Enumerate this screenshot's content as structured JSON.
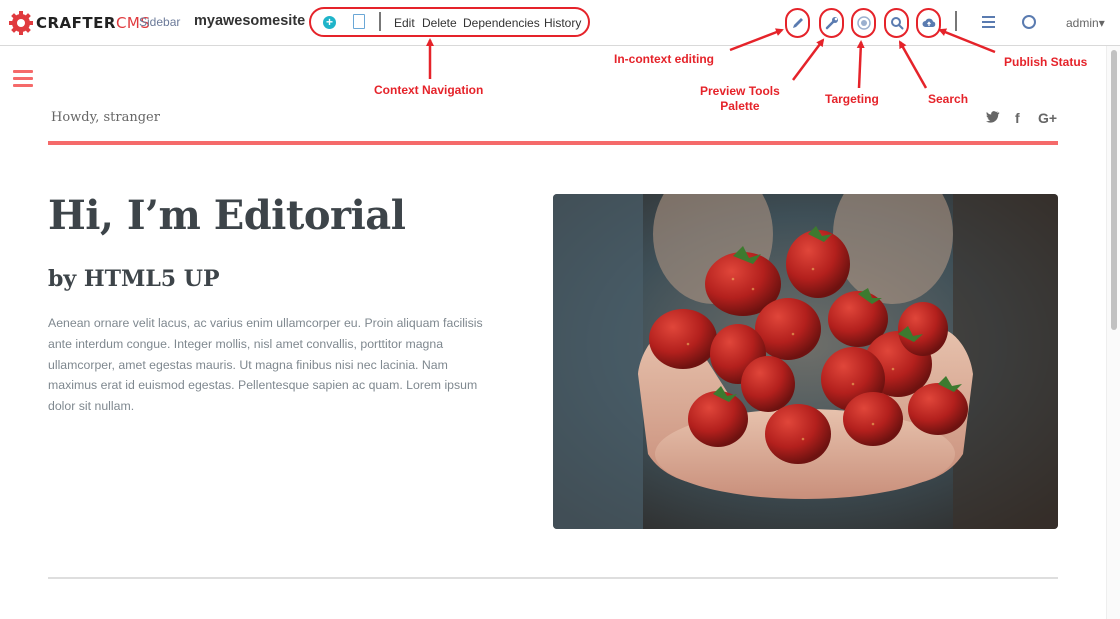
{
  "toolbar": {
    "logo_text_a": "CRAFTER",
    "logo_text_b": "CMS",
    "sidebar_label": "Sidebar",
    "site_name": "myawesomesite",
    "context_nav": {
      "add_icon_glyph": "+",
      "items": [
        "Edit",
        "Delete",
        "Dependencies",
        "History"
      ]
    },
    "user": "admin",
    "user_caret": "▾",
    "icons": [
      "pencil-icon",
      "wrench-icon",
      "target-icon",
      "search-icon",
      "cloud-upload-icon",
      "menu-icon",
      "globe-icon"
    ]
  },
  "annotations": {
    "context_navigation": "Context Navigation",
    "in_context_editing": "In-context editing",
    "preview_tools_palette_line1": "Preview Tools",
    "preview_tools_palette_line2": "Palette",
    "targeting": "Targeting",
    "search": "Search",
    "publish_status": "Publish Status"
  },
  "site": {
    "greeting": "Howdy, stranger",
    "social": [
      "twitter-icon",
      "facebook-icon",
      "google-plus-icon"
    ],
    "social_glyphs": {
      "twitter": "🐦",
      "facebook": "f",
      "gplus": "G+"
    },
    "hero_title": "Hi, I’m Editorial",
    "hero_subtitle": "by HTML5 UP",
    "hero_body": "Aenean ornare velit lacus, ac varius enim ullamcorper eu. Proin aliquam facilisis ante interdum congue. Integer mollis, nisl amet convallis, porttitor magna ullamcorper, amet egestas mauris. Ut magna finibus nisi nec lacinia. Nam maximus erat id euismod egestas. Pellentesque sapien ac quam. Lorem ipsum dolor sit nullam.",
    "hero_image": "strawberries-in-hands-image"
  },
  "colors": {
    "accent": "#f56a6a",
    "annotation": "#e5232a",
    "logo_red": "#e03a3e",
    "add_button": "#1fb4c9"
  }
}
